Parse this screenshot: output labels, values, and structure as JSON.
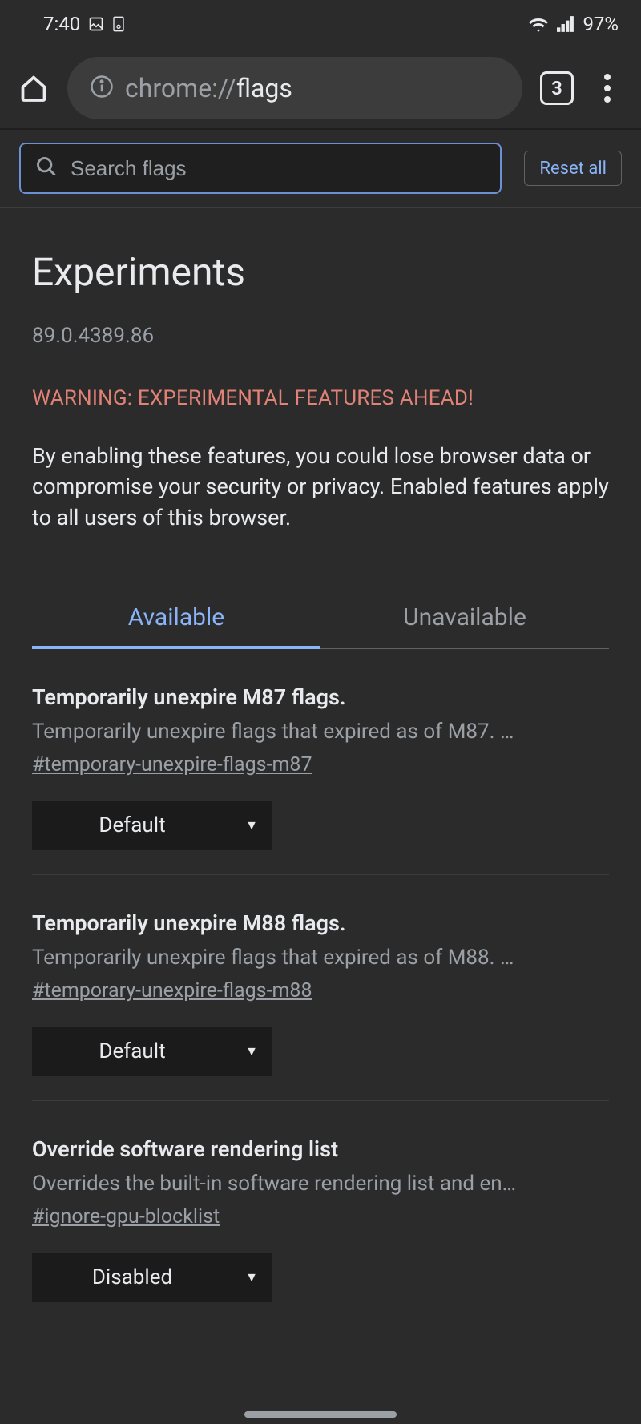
{
  "status": {
    "time": "7:40",
    "battery": "97%"
  },
  "browser": {
    "url_prefix": "chrome://",
    "url_page": "flags",
    "tab_count": "3"
  },
  "search": {
    "placeholder": "Search flags",
    "reset_label": "Reset all"
  },
  "page": {
    "title": "Experiments",
    "version": "89.0.4389.86",
    "warning": "WARNING: EXPERIMENTAL FEATURES AHEAD!",
    "body": "By enabling these features, you could lose browser data or compromise your security or privacy. Enabled features apply to all users of this browser."
  },
  "tabs": {
    "available": "Available",
    "unavailable": "Unavailable"
  },
  "flags": [
    {
      "title": "Temporarily unexpire M87 flags.",
      "desc": "Temporarily unexpire flags that expired as of M87. …",
      "hash": "#temporary-unexpire-flags-m87",
      "value": "Default"
    },
    {
      "title": "Temporarily unexpire M88 flags.",
      "desc": "Temporarily unexpire flags that expired as of M88. …",
      "hash": "#temporary-unexpire-flags-m88",
      "value": "Default"
    },
    {
      "title": "Override software rendering list",
      "desc": "Overrides the built-in software rendering list and en…",
      "hash": "#ignore-gpu-blocklist",
      "value": "Disabled"
    }
  ]
}
